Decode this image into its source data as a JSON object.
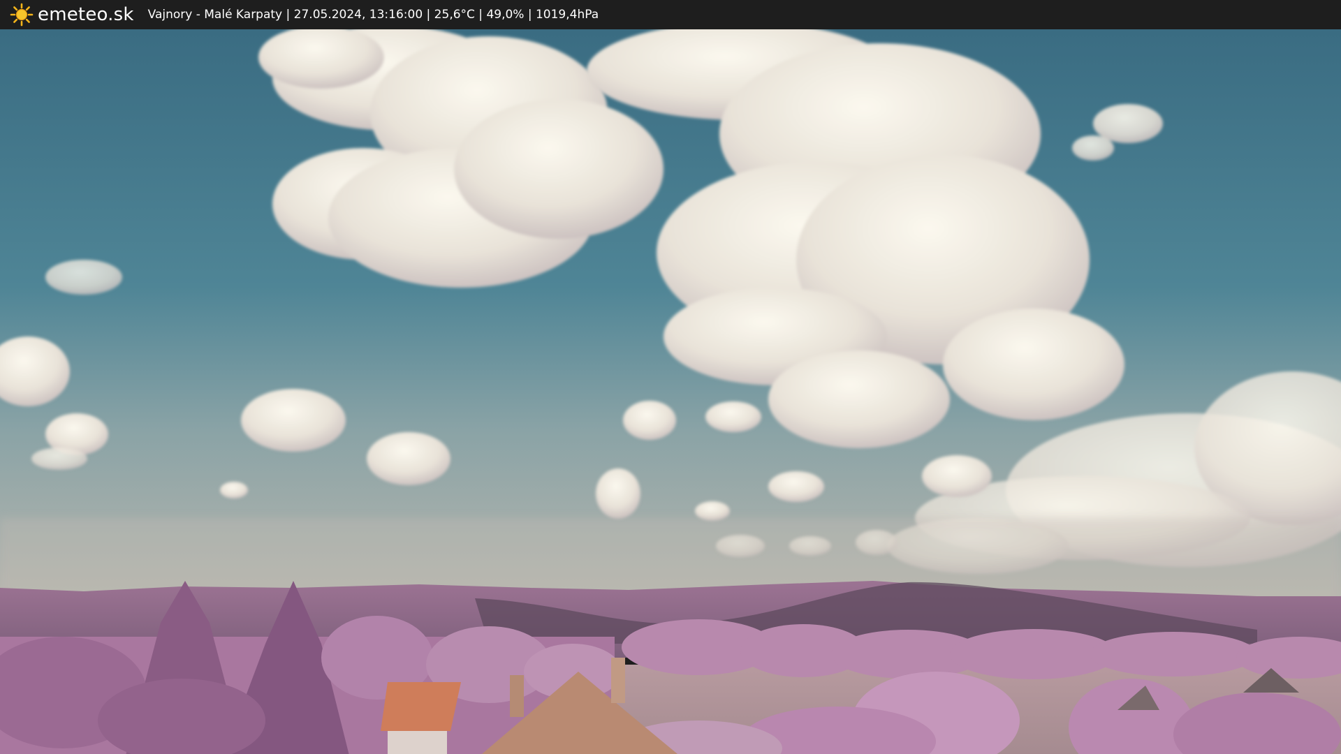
{
  "header": {
    "brand": "emeteo.sk",
    "caption": "Vajnory - Malé Karpaty | 27.05.2024, 13:16:00 | 25,6°C | 49,0% | 1019,4hPa",
    "logo_icon": "sun-icon"
  },
  "image": {
    "description_icon": "webcam-image",
    "colors": {
      "sky_top": "#3a6f84",
      "sky_mid": "#5f93a3",
      "sky_horizon": "#a9b4b2",
      "hills": "#8d6a86",
      "hills_shadow": "#5f4a5e",
      "foliage": "#b786ad",
      "foliage_dark": "#7f5a7a",
      "roof": "#c98a6a",
      "field": "#b9a0a2",
      "bar": "#1e1e1e"
    }
  }
}
